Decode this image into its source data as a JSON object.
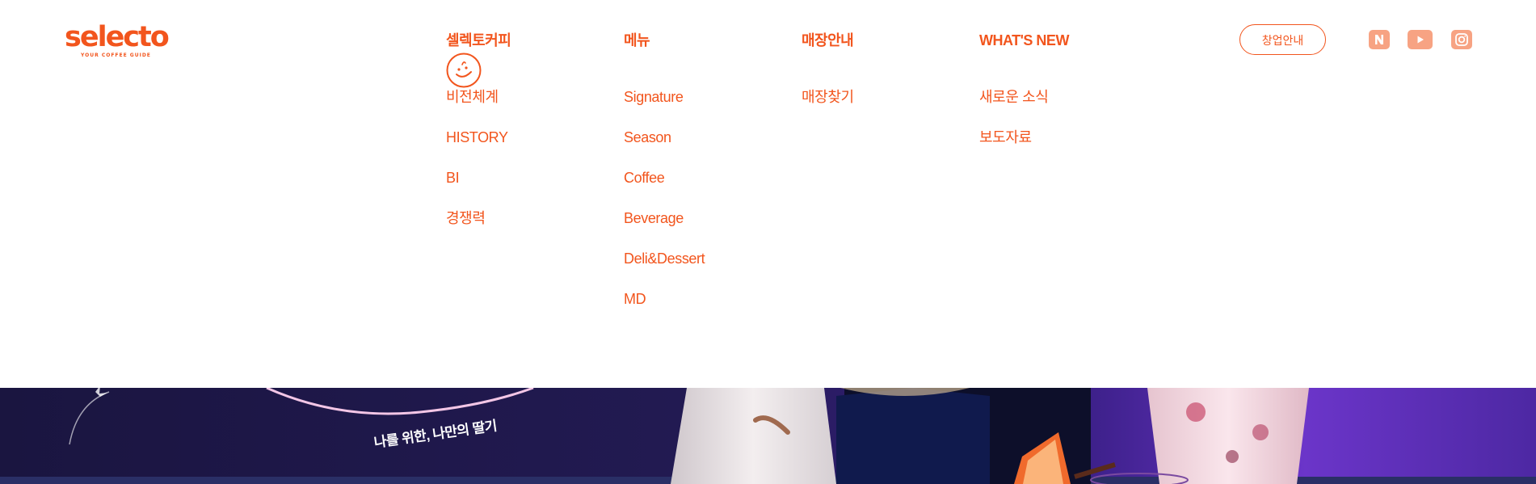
{
  "brand": {
    "name": "selecto",
    "tagline": "YOUR COFFEE GUIDE",
    "color": "#f2551d"
  },
  "nav": [
    {
      "label": "셀렉토커피",
      "items": [
        "비전체계",
        "HISTORY",
        "BI",
        "경쟁력"
      ]
    },
    {
      "label": "메뉴",
      "items": [
        "Signature",
        "Season",
        "Coffee",
        "Beverage",
        "Deli&Dessert",
        "MD"
      ]
    },
    {
      "label": "매장안내",
      "items": [
        "매장찾기"
      ]
    },
    {
      "label": "WHAT'S NEW",
      "items": [
        "새로운 소식",
        "보도자료"
      ]
    }
  ],
  "cta": {
    "label": "창업안내"
  },
  "sns": [
    "naver-blog-icon",
    "youtube-icon",
    "instagram-icon"
  ],
  "banner": {
    "text": "나를 위한, 나만의 딸기"
  }
}
